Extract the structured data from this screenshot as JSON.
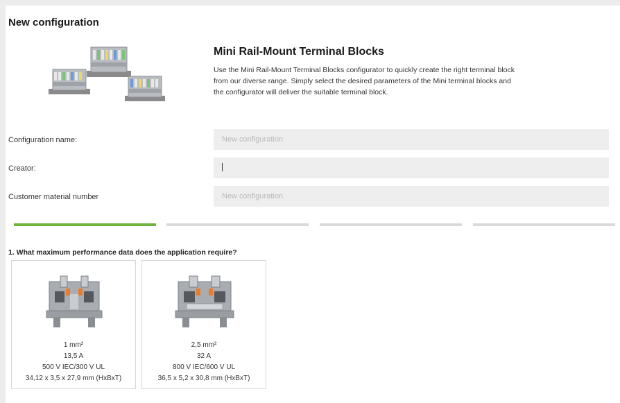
{
  "page": {
    "title": "New configuration"
  },
  "product": {
    "image_icon": "terminal-blocks-image",
    "title": "Mini Rail-Mount Terminal Blocks",
    "description": "Use the Mini Rail-Mount Terminal Blocks configurator to quickly create the right terminal block from our diverse range. Simply select the desired parameters of the Mini terminal blocks and the configurator will deliver the suitable terminal block."
  },
  "form": {
    "config_name": {
      "label": "Configuration name:",
      "placeholder": "New configuration",
      "value": ""
    },
    "creator": {
      "label": "Creator:",
      "placeholder": "",
      "value": ""
    },
    "customer_material": {
      "label": "Customer material number",
      "placeholder": "New configuration",
      "value": ""
    }
  },
  "steps": {
    "total": 4,
    "active": 1
  },
  "question": {
    "text": "1. What maximum performance data does the application require?"
  },
  "options": [
    {
      "cross_section": "1 mm²",
      "current": "13,5 A",
      "voltage": "500 V IEC/300 V UL",
      "dimensions": "34,12 x 3,5 x 27,9 mm (HxBxT)"
    },
    {
      "cross_section": "2,5 mm²",
      "current": "32 A",
      "voltage": "800 V IEC/600 V UL",
      "dimensions": "36,5 x 5,2 x 30,8 mm (HxBxT)"
    }
  ],
  "colors": {
    "accent": "#6fb33a",
    "input_bg": "#eeeeee",
    "track": "#d9d9d9"
  }
}
